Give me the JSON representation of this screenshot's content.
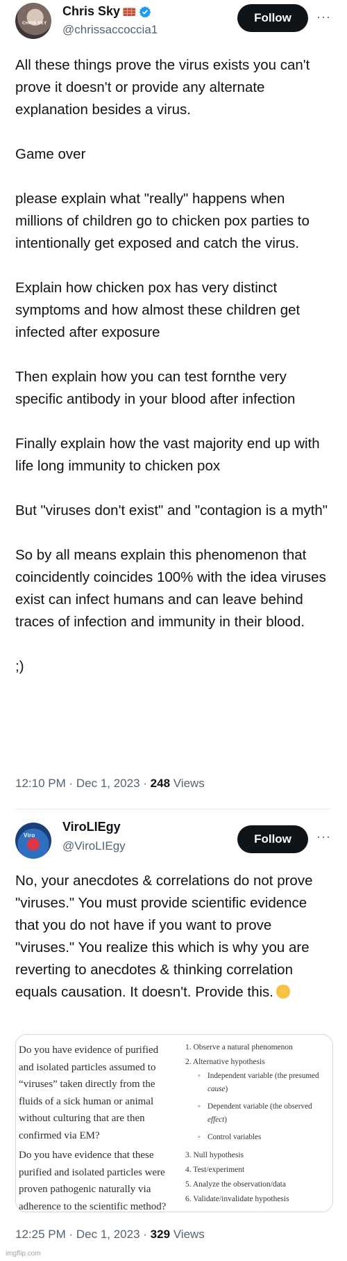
{
  "tweet1": {
    "author": {
      "display_name": "Chris Sky",
      "handle": "@chrissaccoccia1",
      "avatar_label": "CHRIS SKY",
      "verified": true
    },
    "follow_label": "Follow",
    "more_label": "···",
    "paragraphs": [
      "All these things prove the virus exists you can't prove it doesn't or provide any alternate explanation besides a virus.",
      "Game over",
      "please explain what \"really\" happens when millions of children go to chicken pox parties to intentionally get exposed and catch the virus.",
      "Explain how chicken pox has very distinct symptoms and how almost these children get infected after exposure",
      "Then explain how you can test fornthe very specific antibody in your blood after infection",
      "Finally explain how the vast majority end up with life long immunity to chicken pox",
      "But \"viruses don't exist\" and \"contagion is a myth\"",
      "So by all means explain this phenomenon that coincidently coincides 100% with the idea viruses exist can infect humans and can leave behind traces of infection and immunity in their blood.",
      ";)"
    ],
    "time": "12:10 PM · Dec 1, 2023 · ",
    "views_count": "248",
    "views_label": " Views"
  },
  "tweet2": {
    "author": {
      "display_name": "ViroLIEgy",
      "handle": "@ViroLIEgy",
      "avatar_label": "Viro",
      "verified": false
    },
    "follow_label": "Follow",
    "more_label": "···",
    "text": "No, your anecdotes & correlations do not prove \"viruses.\" You must provide scientific evidence that you do not have if you want to prove \"viruses.\" You realize this which is why you are reverting to anecdotes & thinking correlation equals causation. It doesn't. Provide this.",
    "media": {
      "left_q1": [
        "Do you have evidence of purified",
        "and isolated particles assumed to",
        "“viruses” taken directly from the",
        "fluids of a sick human or animal",
        "without culturing that are then",
        "confirmed via EM?"
      ],
      "left_q2": [
        "Do you have evidence that these",
        "purified and isolated particles were",
        "proven pathogenic naturally via",
        "adherence to the scientific method?"
      ],
      "steps": [
        "1.  Observe a natural phenomenon",
        "2.  Alternative hypothesis",
        "3.  Null hypothesis",
        "4.  Test/experiment",
        "5.  Analyze the observation/data",
        "6.  Validate/invalidate hypothesis"
      ],
      "sub_items": [
        {
          "text": "Independent variable (the presumed ",
          "em": "cause",
          "end": ")"
        },
        {
          "text": "Dependent variable (the observed ",
          "em": "effect",
          "end": ")"
        },
        {
          "text": "Control variables",
          "em": "",
          "end": ""
        }
      ]
    },
    "time": "12:25 PM · Dec 1, 2023 · ",
    "views_count": "329",
    "views_label": " Views"
  },
  "watermark": "imgflip.com",
  "colors": {
    "text": "#0f1419",
    "secondary": "#536471",
    "follow_bg": "#0f1419",
    "verified": "#1d9bf0"
  }
}
